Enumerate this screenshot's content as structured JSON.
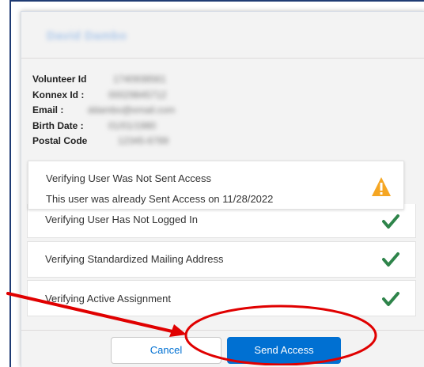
{
  "modal": {
    "header_name": "David Dambo"
  },
  "info": {
    "volunteer_id_label": "Volunteer Id",
    "volunteer_id_value": "1740938561",
    "konnex_id_label": "Konnex Id :",
    "konnex_id_value": "00029845712",
    "email_label": "Email :",
    "email_value": "ddambo@email.com",
    "birth_date_label": "Birth Date :",
    "birth_date_value": "01/01/1980",
    "postal_code_label": "Postal Code",
    "postal_code_value": "12345-6789"
  },
  "checks": [
    {
      "title": "Verifying User Was Not Sent Access",
      "detail": "This user was already Sent Access on 11/28/2022",
      "status": "warning",
      "status_icon": "warning-triangle-icon",
      "color": "#f5a623"
    },
    {
      "title": "Verifying User Has Not Logged In",
      "status": "pass",
      "status_icon": "checkmark-icon",
      "color": "#2e844a"
    },
    {
      "title": "Verifying Standardized Mailing Address",
      "status": "pass",
      "status_icon": "checkmark-icon",
      "color": "#2e844a"
    },
    {
      "title": "Verifying Active Assignment",
      "status": "pass",
      "status_icon": "checkmark-icon",
      "color": "#2e844a"
    }
  ],
  "footer": {
    "cancel_label": "Cancel",
    "send_label": "Send Access"
  },
  "colors": {
    "brand": "#0070d2",
    "annotation": "#e00000",
    "pass": "#2e844a",
    "warning": "#f5a623"
  }
}
